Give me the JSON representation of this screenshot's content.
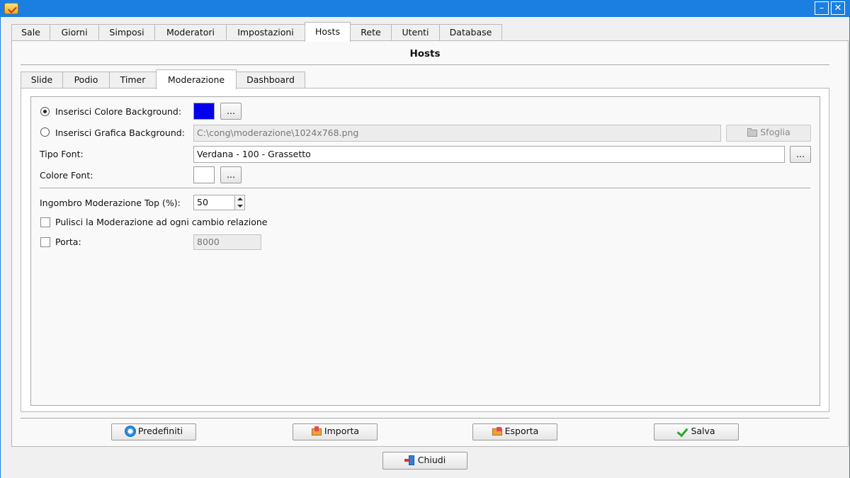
{
  "window": {
    "minimize_glyph": "–",
    "close_glyph": "✕"
  },
  "outer_tabs": [
    "Sale",
    "Giorni",
    "Simposi",
    "Moderatori",
    "Impostazioni",
    "Hosts",
    "Rete",
    "Utenti",
    "Database"
  ],
  "active_outer_tab": "Hosts",
  "section_title": "Hosts",
  "inner_tabs": [
    "Slide",
    "Podio",
    "Timer",
    "Moderazione",
    "Dashboard"
  ],
  "active_inner_tab": "Moderazione",
  "form": {
    "bg_color_label": "Inserisci Colore Background:",
    "bg_color_value": "#0000ee",
    "bg_color_selected": true,
    "ellipsis": "...",
    "bg_image_label": "Inserisci Grafica Background:",
    "bg_image_path": "C:\\cong\\moderazione\\1024x768.png",
    "browse_label": "Sfoglia",
    "font_type_label": "Tipo Font:",
    "font_type_value": "Verdana - 100 - Grassetto",
    "font_color_label": "Colore Font:",
    "font_color_value": "#ffffff",
    "top_size_label": "Ingombro Moderazione Top (%):",
    "top_size_value": "50",
    "clear_label": "Pulisci la Moderazione ad ogni cambio relazione",
    "clear_checked": false,
    "port_label": "Porta:",
    "port_checked": false,
    "port_value": "8000"
  },
  "actions": {
    "defaults": "Predefiniti",
    "import": "Importa",
    "export": "Esporta",
    "save": "Salva",
    "close": "Chiudi"
  }
}
